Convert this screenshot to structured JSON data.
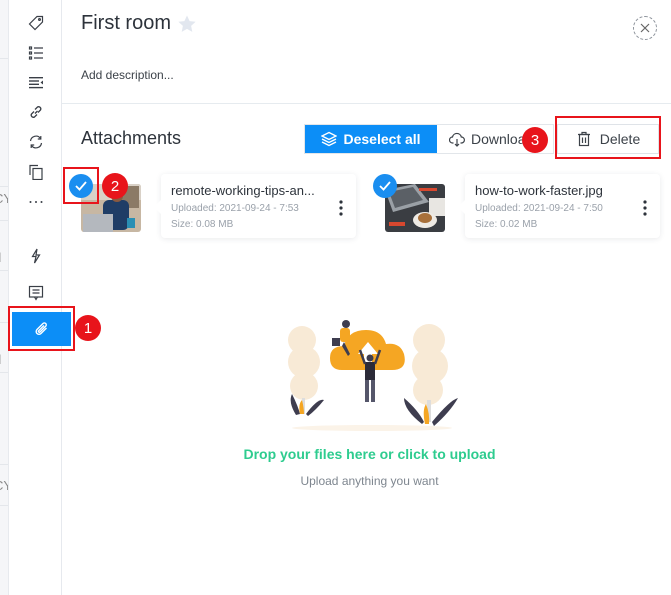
{
  "background_panel": {
    "fragments": [
      "CY",
      "d",
      "l",
      "d",
      "CY"
    ]
  },
  "rail": {
    "items": [
      {
        "name": "tag",
        "icon": "tag-icon"
      },
      {
        "name": "checklist",
        "icon": "checklist-icon"
      },
      {
        "name": "fields",
        "icon": "text-fields-icon"
      },
      {
        "name": "link",
        "icon": "link-icon"
      },
      {
        "name": "recurring",
        "icon": "sync-icon"
      },
      {
        "name": "copy",
        "icon": "copy-icon"
      },
      {
        "name": "more",
        "icon": "more-icon"
      },
      {
        "name": "automation",
        "icon": "lightning-icon"
      },
      {
        "name": "comments",
        "icon": "comment-icon"
      },
      {
        "name": "attachments",
        "icon": "paperclip-icon",
        "active": true
      }
    ]
  },
  "header": {
    "title": "First room",
    "description_placeholder": "Add description..."
  },
  "attachments": {
    "title": "Attachments",
    "buttons": {
      "deselect_all": "Deselect all",
      "download": "Download",
      "delete": "Delete"
    },
    "files": [
      {
        "name": "remote-working-tips-an...",
        "uploaded": "Uploaded: 2021-09-24 - 7:53",
        "size": "Size: 0.08 MB",
        "selected": true
      },
      {
        "name": "how-to-work-faster.jpg",
        "uploaded": "Uploaded: 2021-09-24 - 7:50",
        "size": "Size: 0.02 MB",
        "selected": true
      }
    ]
  },
  "upload": {
    "title": "Drop your files here or click to upload",
    "subtitle": "Upload anything you want"
  },
  "annotations": [
    {
      "label": "1",
      "target": "attachments-rail-button"
    },
    {
      "label": "2",
      "target": "file-select-checkbox"
    },
    {
      "label": "3",
      "target": "delete-button"
    }
  ],
  "colors": {
    "accent": "#0c8ef7",
    "upload_text": "#2ecc8f",
    "annotation": "#e8141b"
  }
}
